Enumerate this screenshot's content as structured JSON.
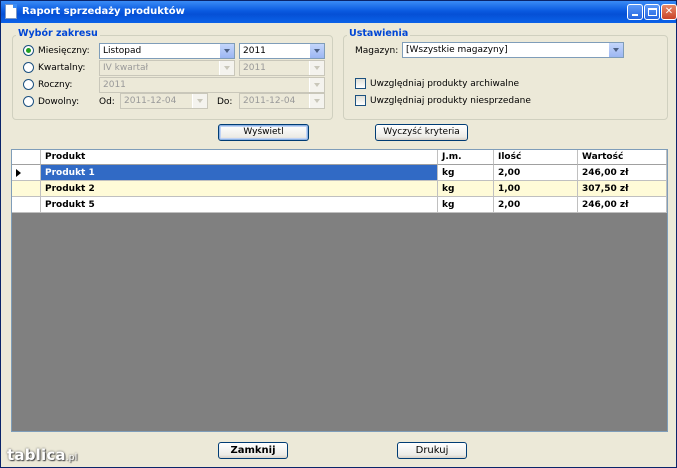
{
  "window": {
    "title": "Raport sprzedaży produktów",
    "minimize_icon": "minimize-icon",
    "maximize_icon": "maximize-icon",
    "close_icon": "close-icon",
    "close_glyph": "✕"
  },
  "range": {
    "legend": "Wybór zakresu",
    "monthly_label": "Miesięczny:",
    "month_value": "Listopad",
    "month_year_value": "2011",
    "quarterly_label": "Kwartalny:",
    "quarter_value": "IV kwartał",
    "quarter_year_value": "2011",
    "yearly_label": "Roczny:",
    "year_value": "2011",
    "custom_label": "Dowolny:",
    "from_label": "Od:",
    "from_value": "2011-12-04",
    "to_label": "Do:",
    "to_value": "2011-12-04",
    "selected": "monthly"
  },
  "settings": {
    "legend": "Ustawienia",
    "warehouse_label": "Magazyn:",
    "warehouse_value": "[Wszystkie magazyny]",
    "include_archived_label": "Uwzględniaj produkty archiwalne",
    "include_archived_checked": false,
    "include_unsold_label": "Uwzględniaj produkty niesprzedane",
    "include_unsold_checked": false
  },
  "actions": {
    "show_label": "Wyświetl",
    "clear_label": "Wyczyść kryteria",
    "close_label": "Zamknij",
    "print_label": "Drukuj"
  },
  "table": {
    "columns": [
      "Produkt",
      "J.m.",
      "Ilość",
      "Wartość"
    ],
    "rows": [
      [
        "Produkt 1",
        "kg",
        "2,00",
        "246,00 zł"
      ],
      [
        "Produkt 2",
        "kg",
        "1,00",
        "307,50 zł"
      ],
      [
        "Produkt 5",
        "kg",
        "2,00",
        "246,00 zł"
      ]
    ],
    "selected_row": 0
  },
  "colors": {
    "selection": "#316ac5",
    "alt_row": "#fffbd8",
    "grid_background": "#808080",
    "legend_text": "#0046d5"
  },
  "watermark": {
    "brand": "tablica",
    "suffix": ".pl"
  }
}
